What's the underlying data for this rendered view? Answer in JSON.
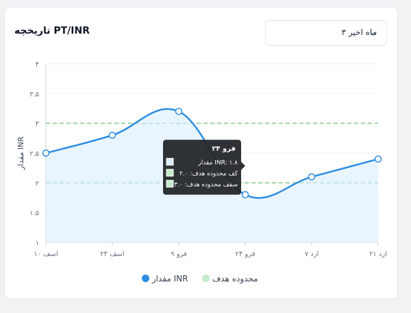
{
  "card": {
    "title": "تاریخچه PT/INR",
    "range_select": {
      "value": "۳ ماه اخیر"
    }
  },
  "chart_data": {
    "type": "line",
    "title": "تاریخچه PT/INR",
    "categories": [
      "۱۰ اسف",
      "۲۴ اسف",
      "۹ فرو",
      "۲۴ فرو",
      "۷ ارد",
      "۲۱ ارد"
    ],
    "series": [
      {
        "name": "مقدار INR",
        "values": [
          2.5,
          2.8,
          3.2,
          1.8,
          2.1,
          2.4
        ],
        "color": "#2b8de3"
      }
    ],
    "target_range": {
      "name": "محدوده هدف",
      "min": 2.0,
      "max": 3.0,
      "color": "#9ad6a3"
    },
    "y_ticks": [
      "۱",
      "۱.۵",
      "۲",
      "۲.۵",
      "۳",
      "۳.۵",
      "۴"
    ],
    "ylabel": "مقدار INR",
    "xlabel": "",
    "ylim": [
      1,
      4
    ],
    "grid": true,
    "legend_position": "bottom",
    "tooltip": {
      "title": "۲۴ فرو",
      "lines": [
        "مقدار INR: ۱.۸",
        "کف محدوده هدف: ۲.۰",
        "سقف محدوده هدف: ۳.۰"
      ]
    }
  },
  "legend": {
    "series_label": "مقدار INR",
    "target_label": "محدوده هدف"
  }
}
